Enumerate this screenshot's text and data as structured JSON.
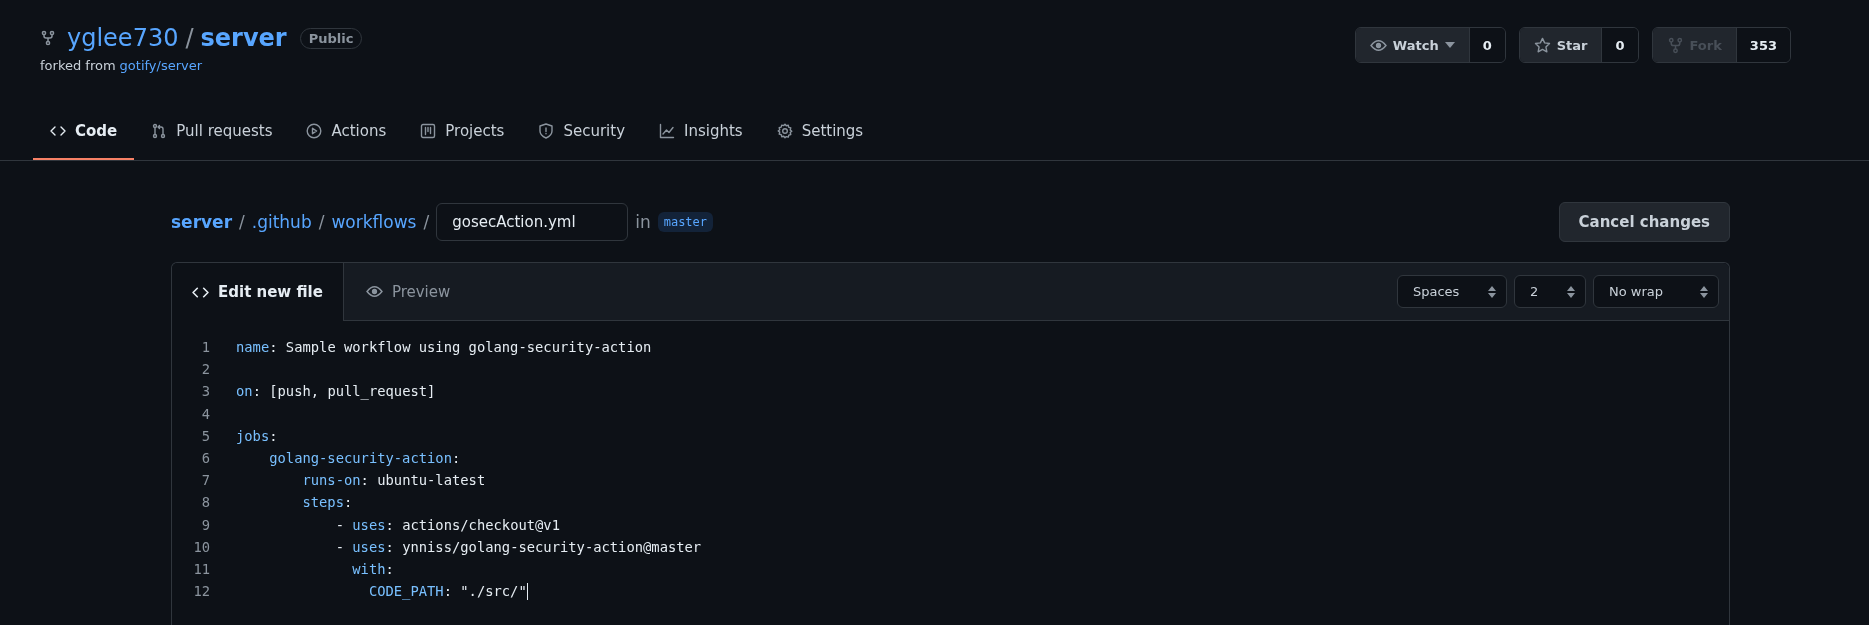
{
  "repo": {
    "owner": "yglee730",
    "separator": "/",
    "name": "server",
    "visibility": "Public",
    "forked_prefix": "forked from",
    "forked_link": "gotify/server"
  },
  "repo_buttons": [
    {
      "label": "Watch",
      "count": "0",
      "disabled": false
    },
    {
      "label": "Star",
      "count": "0",
      "disabled": false
    },
    {
      "label": "Fork",
      "count": "353",
      "disabled": true
    }
  ],
  "nav_tabs": [
    {
      "label": "Code",
      "selected": true
    },
    {
      "label": "Pull requests",
      "selected": false
    },
    {
      "label": "Actions",
      "selected": false
    },
    {
      "label": "Projects",
      "selected": false
    },
    {
      "label": "Security",
      "selected": false
    },
    {
      "label": "Insights",
      "selected": false
    },
    {
      "label": "Settings",
      "selected": false
    }
  ],
  "breadcrumb": [
    {
      "label": "server"
    },
    {
      "label": ".github"
    },
    {
      "label": "workflows"
    }
  ],
  "breadcrumb_separator": "/",
  "filename": "gosecAction.yml",
  "branch_prefix": "in",
  "branch": "master",
  "cancel_button": "Cancel changes",
  "editor_tabs": [
    {
      "label": "Edit new file",
      "selected": true
    },
    {
      "label": "Preview",
      "selected": false
    }
  ],
  "editor_selects": [
    {
      "value": "Spaces"
    },
    {
      "value": "2"
    },
    {
      "value": "No wrap"
    }
  ],
  "code_lines": [
    {
      "number": "1",
      "key": "name",
      "rest": ": Sample workflow using golang-security-action"
    },
    {
      "number": "2"
    },
    {
      "number": "3",
      "key": "on",
      "rest": ": [push, pull_request]"
    },
    {
      "number": "4"
    },
    {
      "number": "5",
      "key": "jobs",
      "rest": ":",
      "children": [
        {
          "number": "6",
          "key": "golang-security-action",
          "rest": ":",
          "children": [
            {
              "number": "7",
              "key": "runs-on",
              "rest": ": ubuntu-latest"
            },
            {
              "number": "8",
              "key": "steps",
              "rest": ":",
              "children": [
                {
                  "number": "9",
                  "prefix": "- ",
                  "key": "uses",
                  "rest": ": actions/checkout@v1"
                },
                {
                  "number": "10",
                  "prefix": "- ",
                  "key": "uses",
                  "rest": ": ynniss/golang-security-action@master",
                  "children": [
                    {
                      "number": "11",
                      "key": "with",
                      "rest": ":",
                      "children": [
                        {
                          "number": "12",
                          "key": "CODE_PATH",
                          "rest": ": \"./src/\"",
                          "cursor": true
                        }
                      ]
                    }
                  ]
                }
              ]
            }
          ]
        }
      ]
    }
  ]
}
